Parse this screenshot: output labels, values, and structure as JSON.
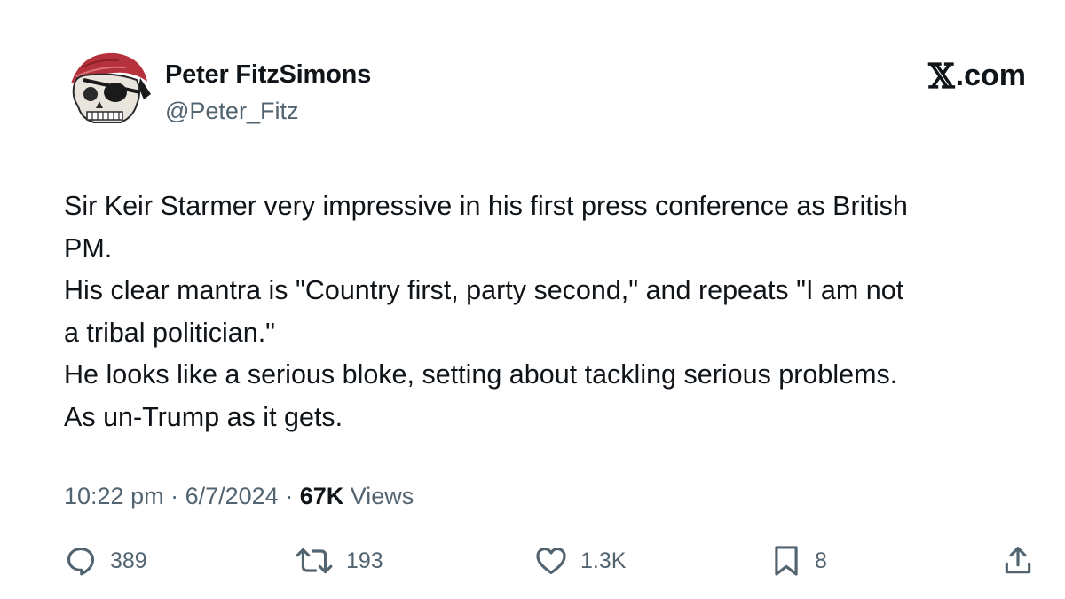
{
  "author": {
    "display_name": "Peter FitzSimons",
    "handle": "@Peter_Fitz",
    "avatar_icon": "pirate-skull-bandana-icon"
  },
  "brand": {
    "logo": "𝕏",
    "suffix": ".com"
  },
  "tweet": {
    "lines": [
      "Sir Keir Starmer very impressive in his first press conference as British",
      "PM.",
      "His clear mantra is \"Country first, party second,\" and repeats \"I am not",
      "a tribal politician.\"",
      "He looks like a serious bloke, setting about tackling serious problems.",
      "As un-Trump as it gets."
    ]
  },
  "meta": {
    "time": "10:22 pm",
    "separator": " · ",
    "date": "6/7/2024",
    "views_count": "67K",
    "views_label": " Views"
  },
  "actions": {
    "replies": "389",
    "reposts": "193",
    "likes": "1.3K",
    "bookmarks": "8"
  },
  "colors": {
    "text_primary": "#0f1419",
    "text_secondary": "#536471",
    "bandana_red": "#b5323c"
  }
}
